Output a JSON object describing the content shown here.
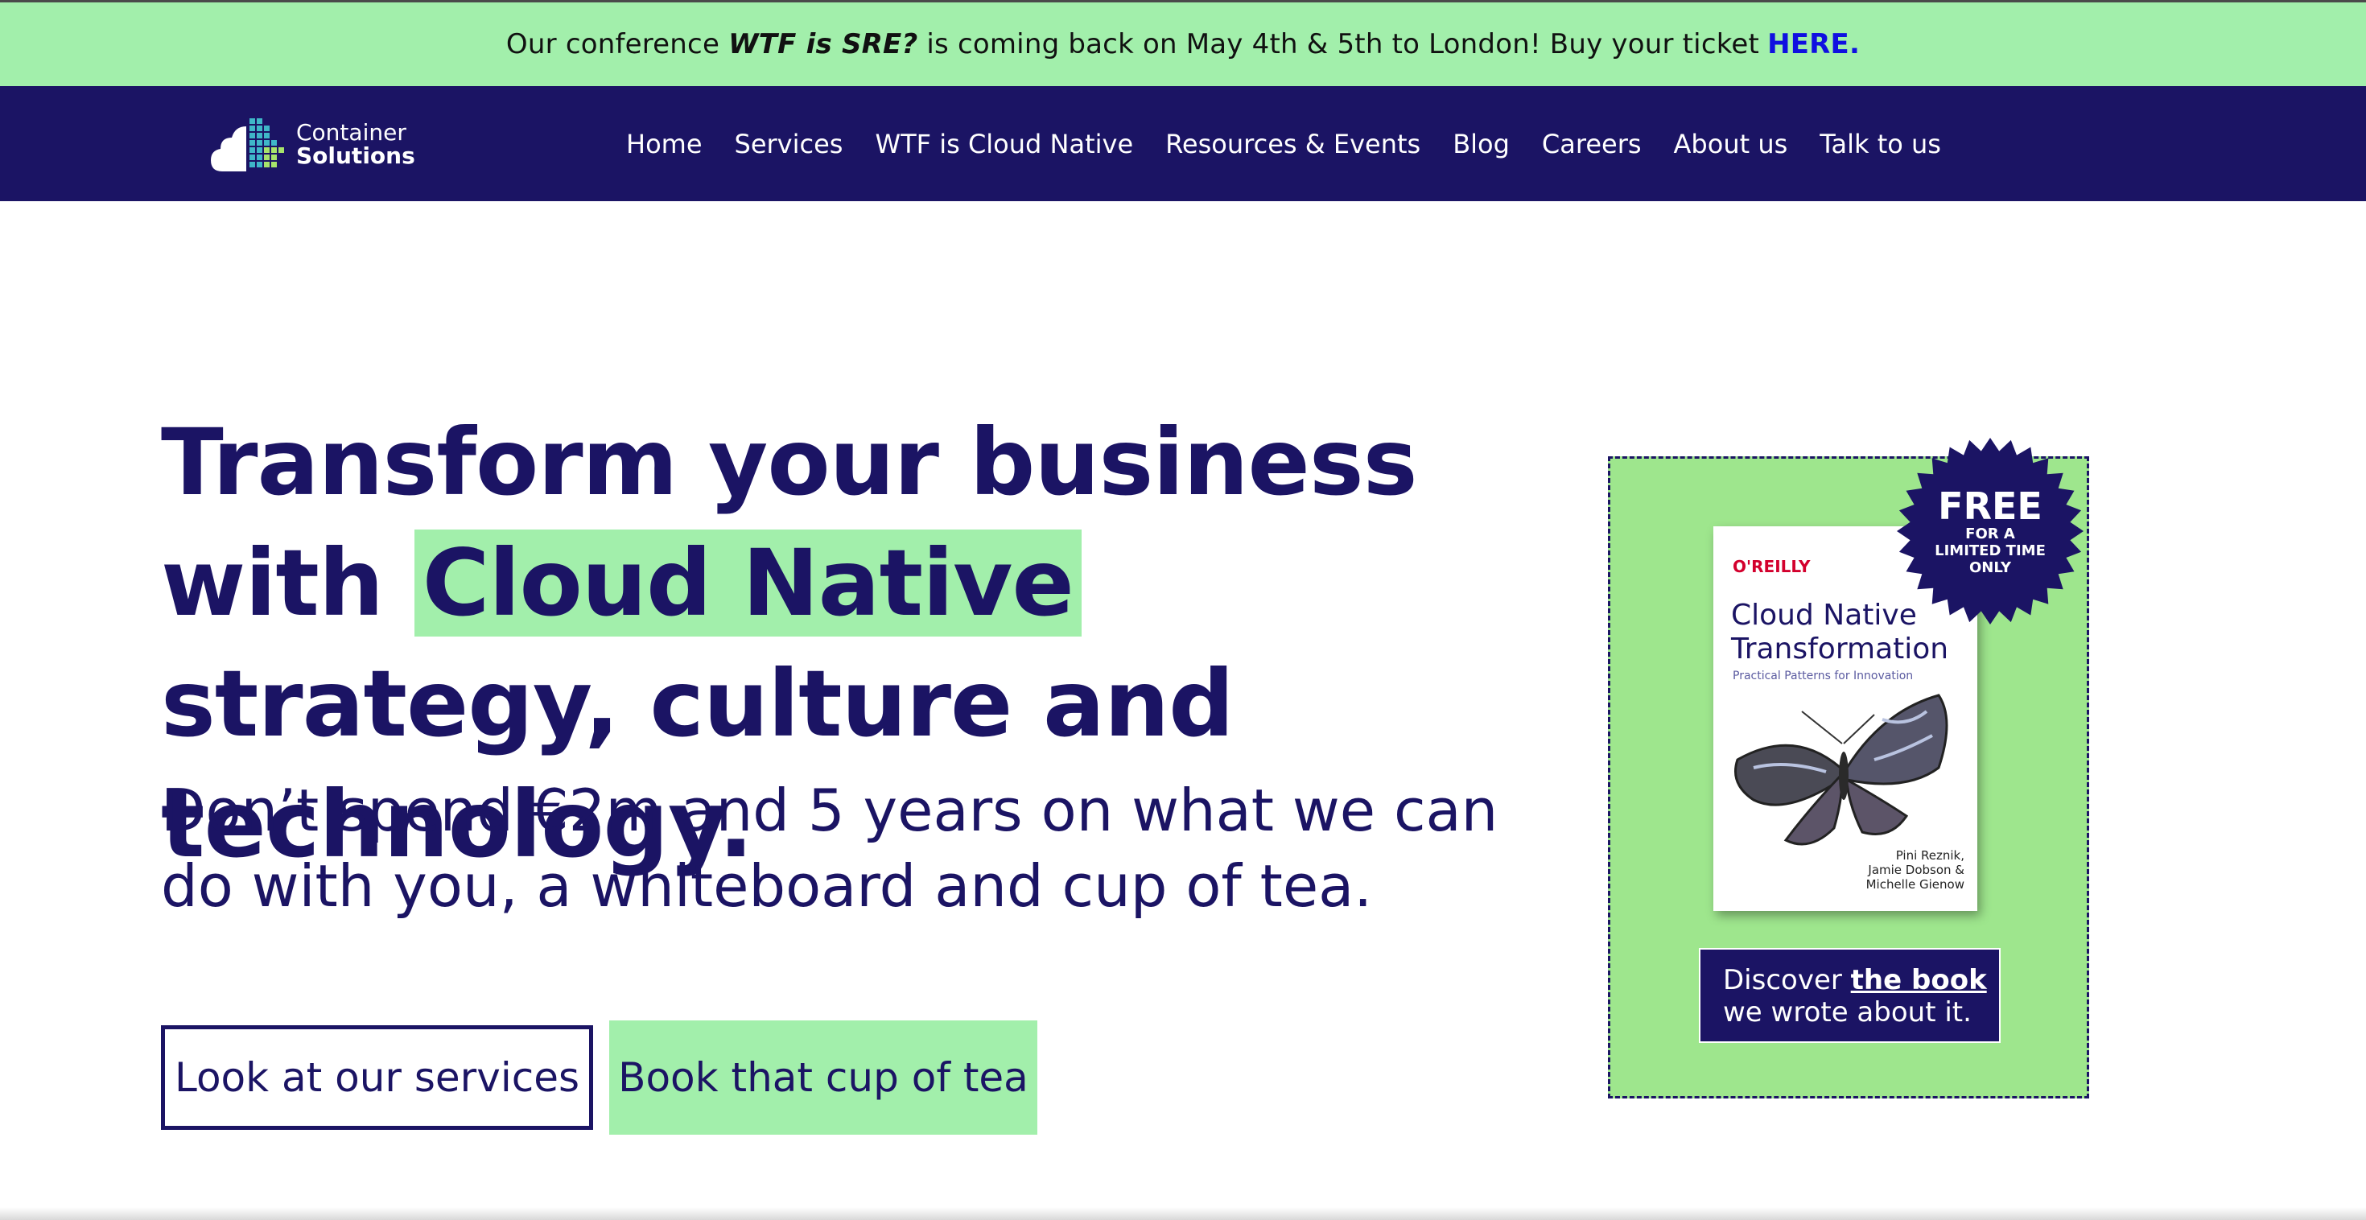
{
  "announcement": {
    "prefix": "Our conference ",
    "event": "WTF is SRE?",
    "suffix": " is coming back on May 4th & 5th to London! Buy your ticket",
    "link": "HERE."
  },
  "nav": {
    "logo": {
      "line1": "Container",
      "line2": "Solutions"
    },
    "items": [
      {
        "label": "Home"
      },
      {
        "label": "Services"
      },
      {
        "label": "WTF is Cloud Native"
      },
      {
        "label": "Resources & Events"
      },
      {
        "label": "Blog"
      },
      {
        "label": "Careers"
      },
      {
        "label": "About us"
      },
      {
        "label": "Talk to us"
      }
    ]
  },
  "hero": {
    "title_part1": "Transform your business with ",
    "title_highlight": "Cloud Native",
    "title_part2": " strategy, culture and technology.",
    "subtitle": "Don’t spend €2m and 5 years on what we can do with you, a whiteboard and cup of tea.",
    "primary_button": "Look at our services",
    "secondary_button": "Book that cup of tea"
  },
  "promo": {
    "badge_big": "FREE",
    "badge_small": "FOR A LIMITED TIME ONLY",
    "book": {
      "publisher": "O'REILLY",
      "title": "Cloud Native Transformation",
      "subtitle": "Practical Patterns for Innovation",
      "authors": "Pini Reznik,\nJamie Dobson &\nMichelle Gienow"
    },
    "cta_start": "Discover ",
    "cta_bold": "the book",
    "cta_end": "we wrote about it."
  },
  "colors": {
    "navy": "#1b1464",
    "mint": "#a2efab",
    "promo_green": "#9ee68d",
    "link_blue": "#1010e0"
  }
}
